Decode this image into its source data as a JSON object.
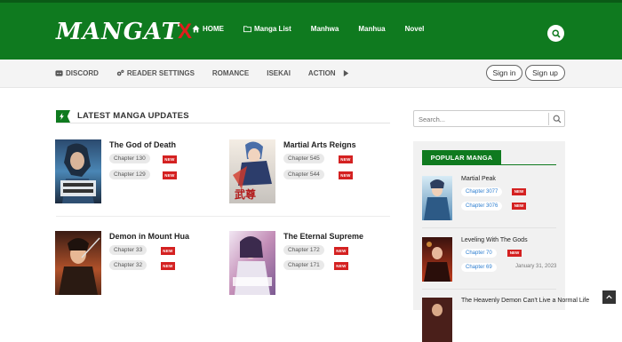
{
  "logo": {
    "text": "MANGAT",
    "mark": "X"
  },
  "nav": [
    {
      "label": "HOME",
      "icon": "home-icon"
    },
    {
      "label": "Manga List",
      "icon": "folder-icon"
    },
    {
      "label": "Manhwa"
    },
    {
      "label": "Manhua"
    },
    {
      "label": "Novel"
    }
  ],
  "subnav": [
    {
      "label": "DISCORD",
      "icon": "discord-icon"
    },
    {
      "label": "READER SETTINGS",
      "icon": "gears-icon"
    },
    {
      "label": "ROMANCE"
    },
    {
      "label": "ISEKAI"
    },
    {
      "label": "ACTION",
      "icon": "caret-right-icon"
    }
  ],
  "auth": {
    "signin": "Sign in",
    "signup": "Sign up"
  },
  "section": {
    "title": "LATEST MANGA UPDATES"
  },
  "latest": [
    {
      "title": "The God of Death",
      "chapters": [
        {
          "label": "Chapter 130",
          "badge": "NEW"
        },
        {
          "label": "Chapter 129",
          "badge": "NEW"
        }
      ]
    },
    {
      "title": "Martial Arts Reigns",
      "chapters": [
        {
          "label": "Chapter 545",
          "badge": "NEW"
        },
        {
          "label": "Chapter 544",
          "badge": "NEW"
        }
      ]
    },
    {
      "title": "Demon in Mount Hua",
      "chapters": [
        {
          "label": "Chapter 33",
          "badge": "NEW"
        },
        {
          "label": "Chapter 32",
          "badge": "NEW"
        }
      ]
    },
    {
      "title": "The Eternal Supreme",
      "chapters": [
        {
          "label": "Chapter 172",
          "badge": "NEW"
        },
        {
          "label": "Chapter 171",
          "badge": "NEW"
        }
      ]
    }
  ],
  "search": {
    "placeholder": "Search..."
  },
  "popular": {
    "title": "POPULAR MANGA",
    "items": [
      {
        "title": "Martial Peak",
        "chapters": [
          {
            "label": "Chapter 3077",
            "badge": "NEW"
          },
          {
            "label": "Chapter 3076",
            "badge": "NEW"
          }
        ]
      },
      {
        "title": "Leveling With The Gods",
        "chapters": [
          {
            "label": "Chapter 70",
            "badge": "NEW"
          },
          {
            "label": "Chapter 69",
            "date": "January 31, 2023"
          }
        ]
      },
      {
        "title": "The Heavenly Demon Can't Live a Normal Life"
      }
    ]
  },
  "colors": {
    "brand_green": "#0f7a1f",
    "badge_red": "#d42121",
    "chapter_blue": "#2f7fd0"
  }
}
